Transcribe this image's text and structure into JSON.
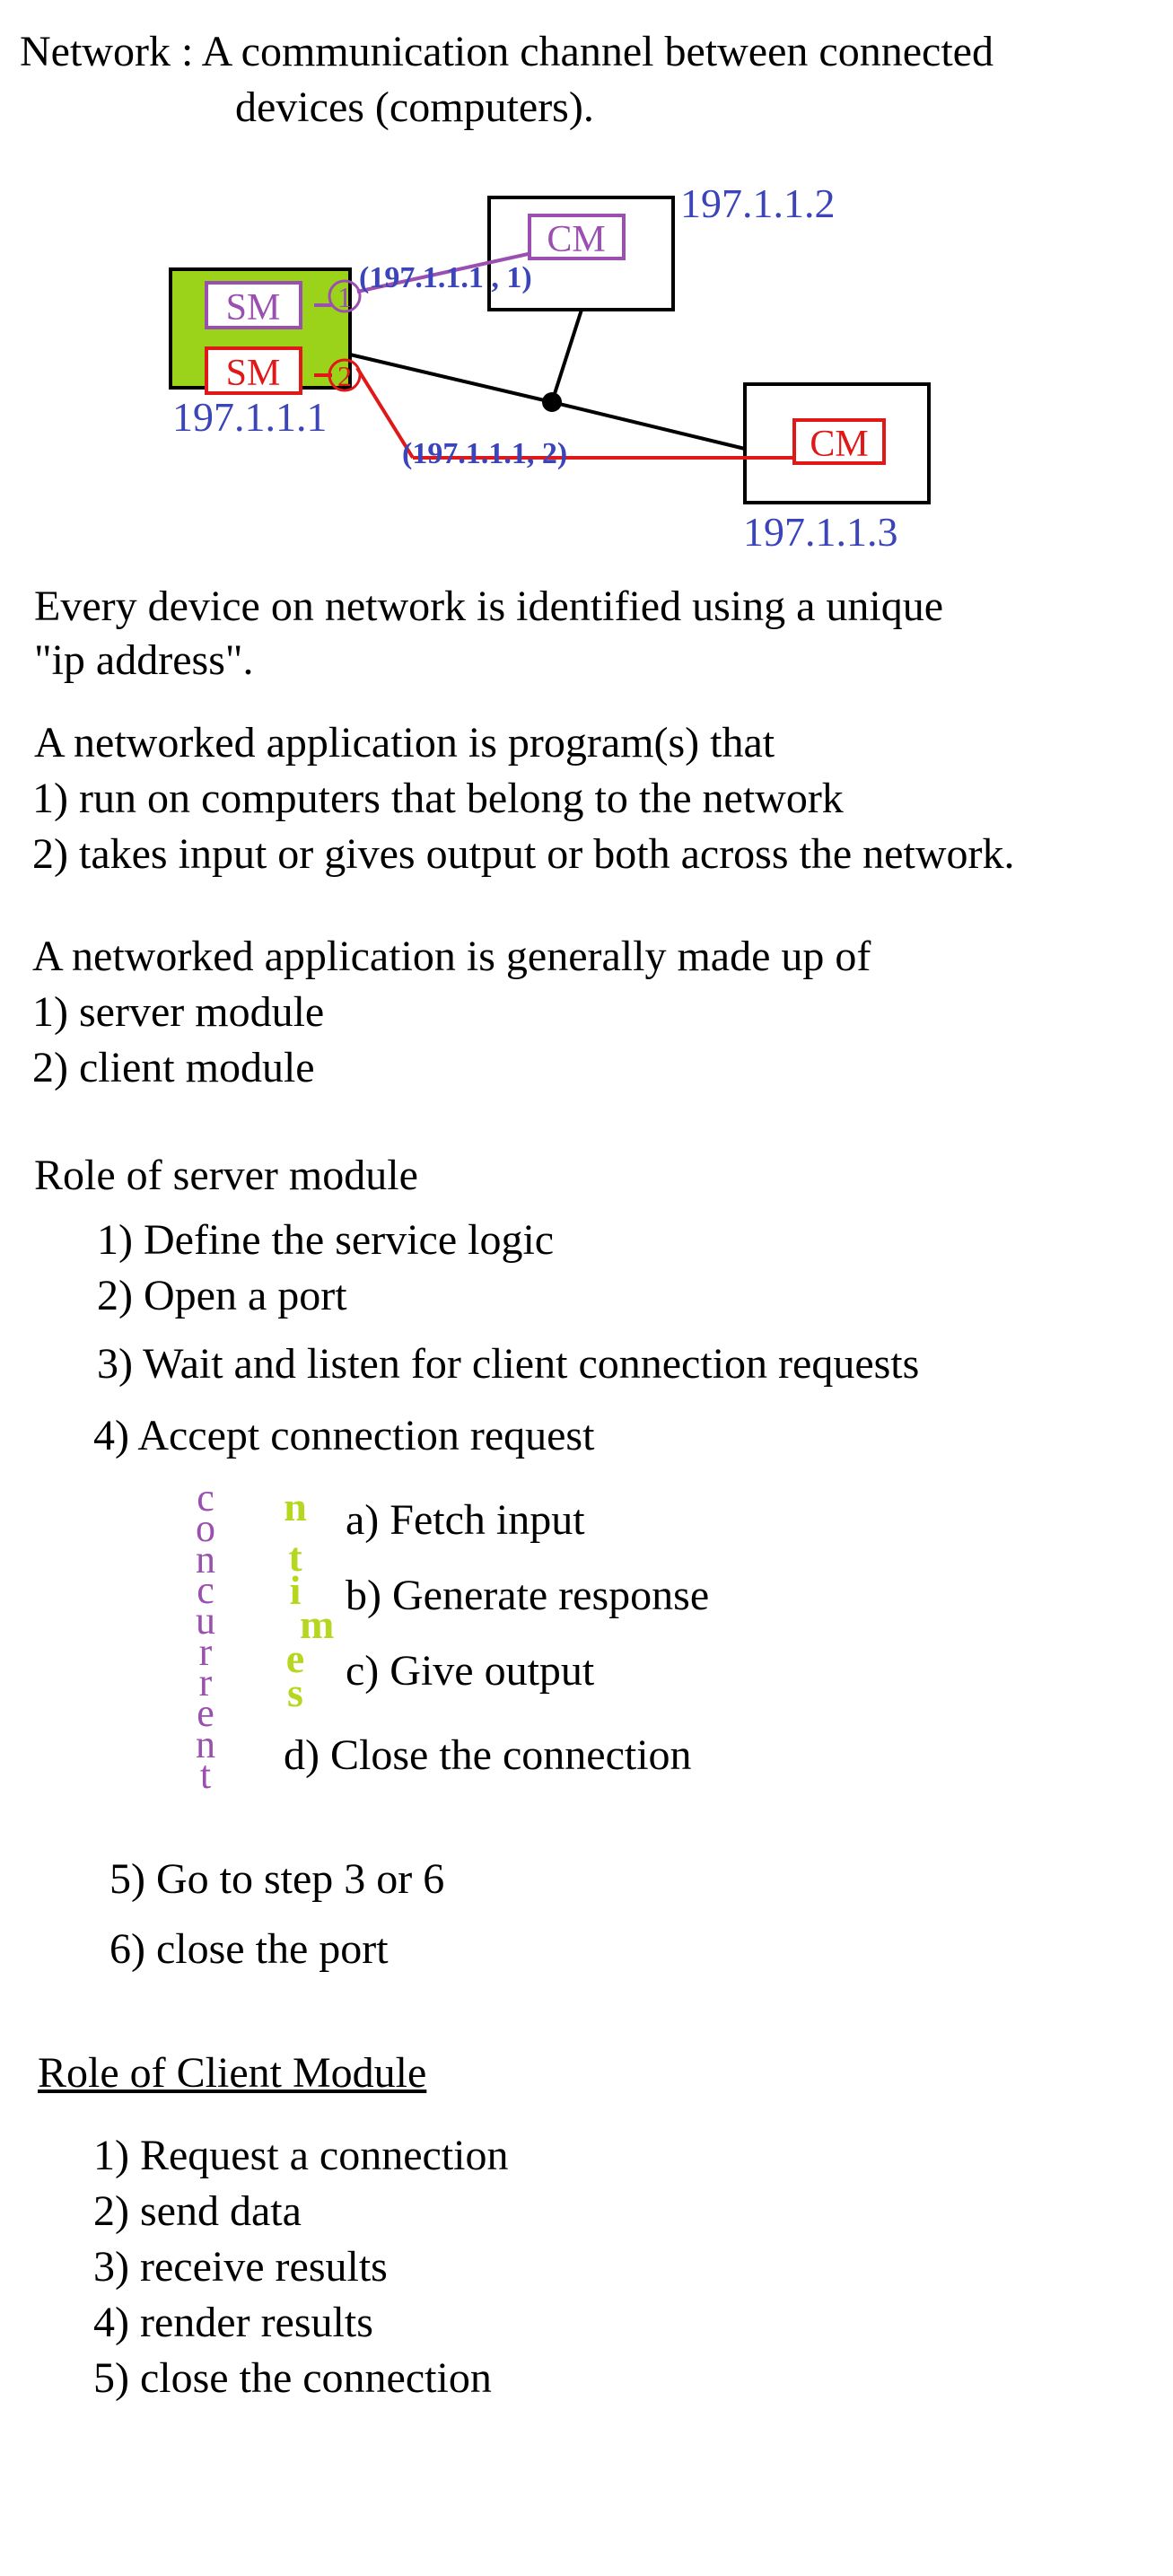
{
  "definition": {
    "line1": "Network : A communication channel between connected",
    "line2": "devices (computers)."
  },
  "diagram": {
    "server_ip": "197.1.1.1",
    "client1_ip": "197.1.1.2",
    "client2_ip": "197.1.1.3",
    "server_module_label": "SM",
    "client_module_label": "CM",
    "port1": "1",
    "port2": "2",
    "socket1": "(197.1.1.1 , 1)",
    "socket2": "(197.1.1.1, 2)",
    "colors": {
      "server_fill": "#9bd31a",
      "purple": "#9b4fb0",
      "red": "#e01818",
      "blue": "#3b44b8"
    }
  },
  "ip_note": {
    "line1": "Every device on network is identified using a unique",
    "line2": "\"ip address\"."
  },
  "networked_app": {
    "intro": "A networked application is program(s) that",
    "points": [
      "1) run on computers that belong to the network",
      "2) takes input or gives output or both across the network."
    ]
  },
  "made_of": {
    "intro": "A networked application is generally made up of",
    "points": [
      "1) server module",
      "2) client module"
    ]
  },
  "server_role": {
    "title": "Role of server module",
    "steps": [
      "1) Define the service logic",
      "2) Open a port",
      "3) Wait and listen for client connection requests",
      "4) Accept  connection request"
    ],
    "substeps": [
      "a) Fetch input",
      "b) Generate response",
      "c) Give output",
      "d) Close the connection"
    ],
    "after_steps": [
      "5) Go to step 3  or 6",
      "6) close the port"
    ],
    "concurrent_letters": [
      "c",
      "o",
      "n",
      "c",
      "u",
      "r",
      "r",
      "e",
      "n",
      "t"
    ],
    "ntimes_letters": [
      "n",
      "t",
      "i",
      "m",
      "e",
      "s"
    ]
  },
  "client_role": {
    "title": "Role of Client Module",
    "steps": [
      "1) Request a connection",
      "2) send data",
      "3) receive results",
      "4) render results",
      "5) close the connection"
    ]
  }
}
